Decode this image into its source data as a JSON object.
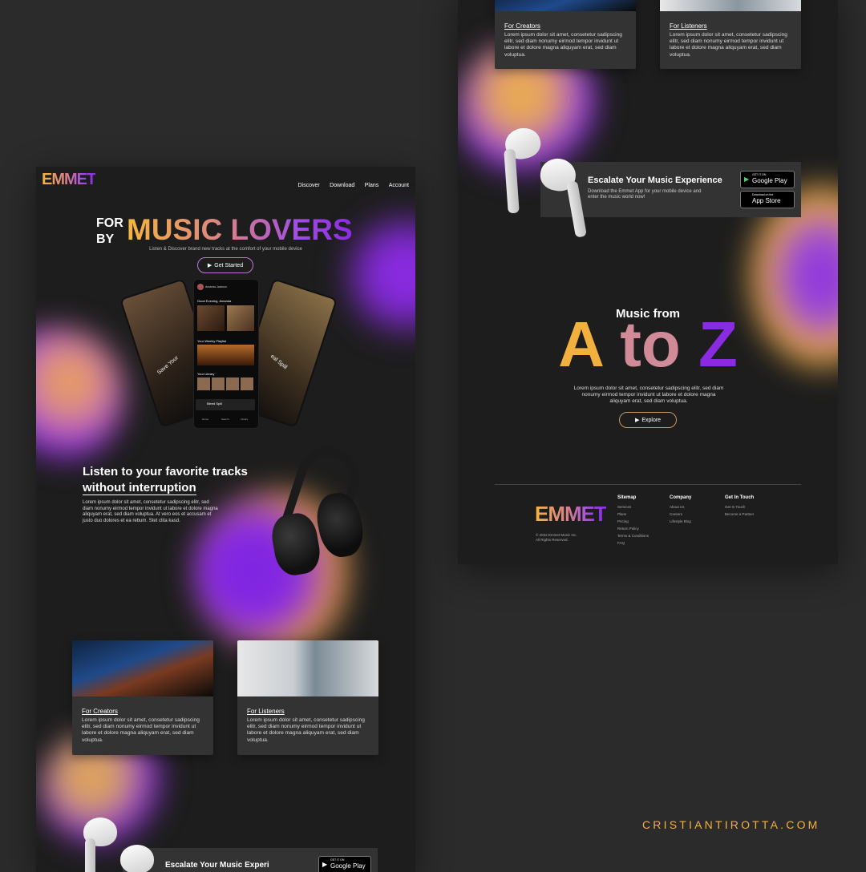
{
  "brand": {
    "logo": "EMMET"
  },
  "nav": {
    "discover": "Discover",
    "download": "Download",
    "plans": "Plans",
    "account": "Account"
  },
  "hero": {
    "for": "FOR",
    "by": "BY",
    "headline": "MUSIC LOVERS",
    "subtitle": "Listen & Discover brand new tracks at the comfort of your mobile device",
    "cta": "Get Started"
  },
  "phone": {
    "user": "Amanda Jackson",
    "greeting": "Good Evening, Amanda",
    "weekly": "Your Weekly Playlist",
    "library": "Your Library",
    "now_playing": "Bleed Spill",
    "left_title": "Save Your",
    "right_title": "eal Spill",
    "tab1": "Home",
    "tab2": "Search",
    "tab3": "Library"
  },
  "feature": {
    "title_line1": "Listen to your favorite tracks",
    "title_line2": "without interruption",
    "body": "Lorem ipsum dolor sit amet, consetetur sadipscing elitr, sed diam nonumy eirmod tempor invidunt ut labore et dolore magna aliquyam erat, sed diam voluptua. At vero eos et accusam et justo duo dolores et ea rebum. Stet clita kasd."
  },
  "cards": [
    {
      "title": "For Creators",
      "body": "Lorem ipsum dolor sit amet, consetetur sadipscing elitr, sed diam nonumy eirmod tempor invidunt ut labore et dolore magna aliquyam erat, sed diam voluptua."
    },
    {
      "title": "For Listeners",
      "body": "Lorem ipsum dolor sit amet, consetetur sadipscing elitr, sed diam nonumy eirmod tempor invidunt ut labore et dolore magna aliquyam erat, sed diam voluptua."
    }
  ],
  "escalate": {
    "title": "Escalate Your Music Experience",
    "body": "Download the Emmet App for your mobile device and enter the music world now!",
    "title_partial": "Escalate Your Music Experi",
    "gp_small": "GET IT ON",
    "gp_big": "Google Play",
    "as_small": "Download on the",
    "as_big": "App Store"
  },
  "atoz": {
    "pre": "Music from",
    "a": "A",
    "to": "to",
    "z": "Z",
    "body": "Lorem ipsum dolor sit amet, consetetur sadipscing elitr, sed diam nonumy eirmod tempor invidunt ut labore et dolore magna aliquyam erat, sed diam voluptua.",
    "cta": "Explore"
  },
  "footer": {
    "copyright1": "© 2022 Emmet Music Inc.",
    "copyright2": "All Rights Reserved.",
    "sitemap": {
      "title": "Sitemap",
      "items": [
        "Services",
        "Plans",
        "Pricing",
        "Return Policy",
        "Terms & Conditions",
        "FAQ"
      ]
    },
    "company": {
      "title": "Company",
      "items": [
        "About Us",
        "Careers",
        "Lifestyle Blog"
      ]
    },
    "contact": {
      "title": "Get In Touch",
      "items": [
        "Get In Touch",
        "Become a Partner"
      ]
    }
  },
  "credit": "CRISTIANTIROTTA.COM",
  "colors": {
    "gold": "#f6b53b",
    "purple": "#8a2be2",
    "panel": "#1d1d1d",
    "background": "#2b2b2b"
  },
  "icons": [
    "play-icon",
    "headphones-image",
    "airpods-image",
    "google-play-icon",
    "apple-icon"
  ]
}
